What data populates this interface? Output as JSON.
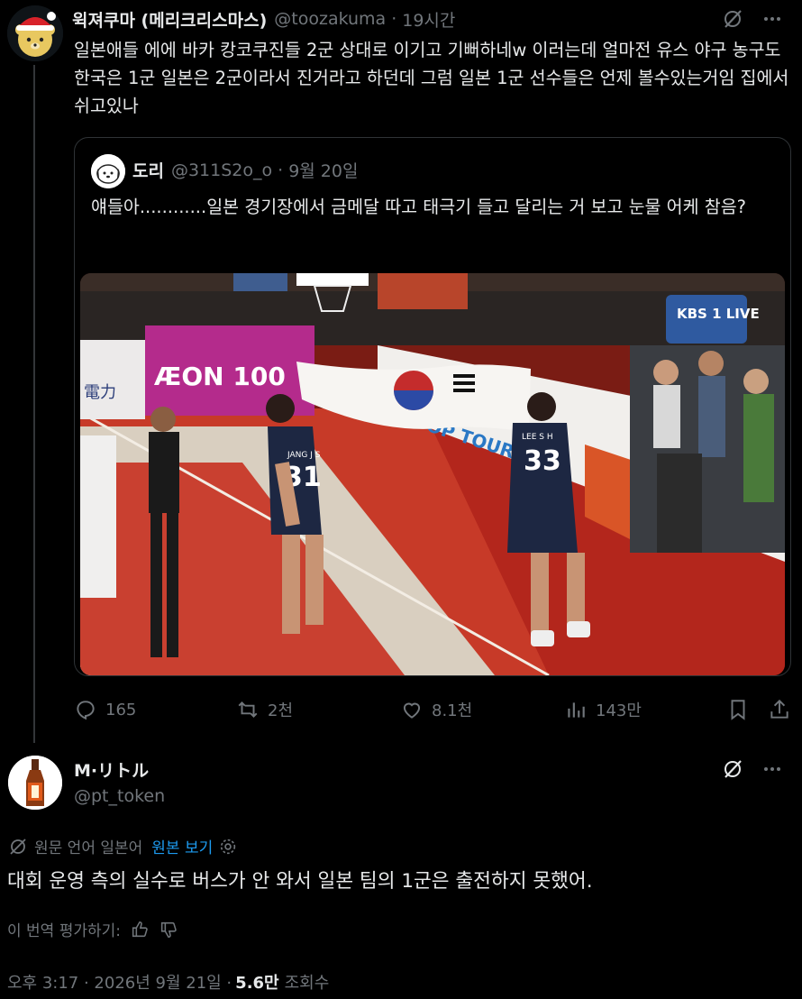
{
  "main_post": {
    "display_name": "윅져쿠마 (메리크리스마스)",
    "handle": "@toozakuma",
    "time": "19시간",
    "text": "일본애들 에에 바카 캉코쿠진들 2군 상대로 이기고 기뻐하네w 이러는데 얼마전 유스 야구 농구도 한국은 1군 일본은 2군이라서 진거라고 하던데 그럼 일본 1군 선수들은 언제 볼수있는거임 집에서 쉬고있나",
    "quote": {
      "display_name": "도리",
      "handle": "@311S2o_o",
      "time": "9월 20일",
      "text": "얘들아............일본 경기장에서 금메달 따고 태극기 들고 달리는 거 보고 눈물 어케 참음?",
      "media": {
        "banner_text": "ÆON 100",
        "broadcaster": "KBS 1 LIVE",
        "jersey_left_name": "JANG J S",
        "jersey_left_number": "31",
        "jersey_right_name": "LEE S H",
        "jersey_right_number": "33",
        "sign_left": "電力",
        "sign_right": "TOP TOURS"
      }
    },
    "actions": {
      "replies": "165",
      "reposts": "2천",
      "likes": "8.1천",
      "views": "143만"
    }
  },
  "reply_post": {
    "display_name": "M·リトル",
    "handle": "@pt_token",
    "translation_note": "원문 언어 일본어",
    "translation_link": "원본 보기",
    "text": "대회 운영 측의 실수로 버스가 안 와서 일본 팀의 1군은 출전하지 못했어.",
    "rate_label": "이 번역 평가하기:",
    "timestamp": "오후 3:17 · 2026년 9월 21일 · ",
    "views_count": "5.6만",
    "views_label": "조회수"
  },
  "colors": {
    "background": "#000000",
    "text_primary": "#e7e9ea",
    "text_secondary": "#71767b",
    "link": "#1d9bf0",
    "border": "#2f3336"
  }
}
